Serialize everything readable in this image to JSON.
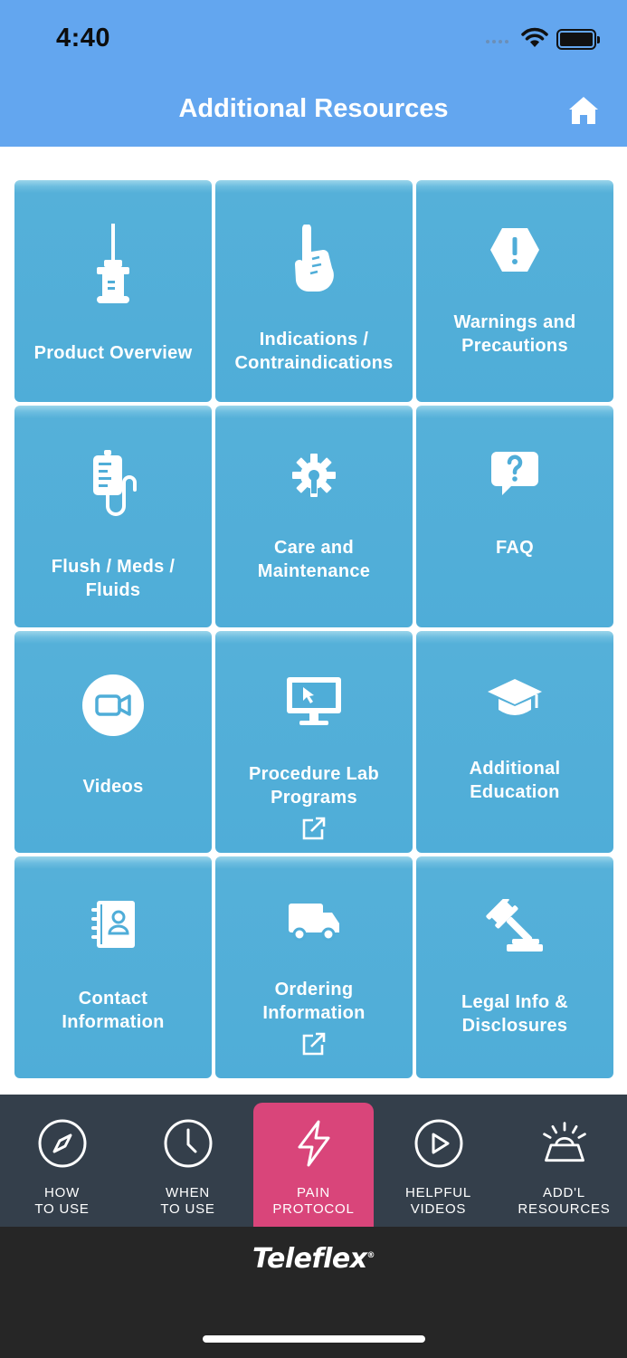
{
  "status_bar": {
    "time": "4:40"
  },
  "header": {
    "title": "Additional Resources",
    "home_icon": "home-icon"
  },
  "tiles": [
    {
      "label": "Product Overview",
      "icon": "catheter-icon",
      "external": false
    },
    {
      "label": "Indications /\nContraindications",
      "icon": "pointing-hand-icon",
      "external": false
    },
    {
      "label": "Warnings and\nPrecautions",
      "icon": "warning-hexagon-icon",
      "external": false
    },
    {
      "label": "Flush / Meds /\nFluids",
      "icon": "iv-bag-icon",
      "external": false
    },
    {
      "label": "Care and\nMaintenance",
      "icon": "wrench-gear-icon",
      "external": false
    },
    {
      "label": "FAQ",
      "icon": "question-bubble-icon",
      "external": false
    },
    {
      "label": "Videos",
      "icon": "video-camera-icon",
      "external": false
    },
    {
      "label": "Procedure Lab\nPrograms",
      "icon": "monitor-cursor-icon",
      "external": true
    },
    {
      "label": "Additional\nEducation",
      "icon": "graduation-cap-icon",
      "external": false
    },
    {
      "label": "Contact\nInformation",
      "icon": "address-book-icon",
      "external": false
    },
    {
      "label": "Ordering\nInformation",
      "icon": "delivery-truck-icon",
      "external": true
    },
    {
      "label": "Legal Info &\nDisclosures",
      "icon": "gavel-icon",
      "external": false
    }
  ],
  "tabbar": {
    "active_index": 2,
    "tabs": [
      {
        "label": "HOW\nTO USE",
        "icon": "compass-icon"
      },
      {
        "label": "WHEN\nTO USE",
        "icon": "clock-icon"
      },
      {
        "label": "PAIN\nPROTOCOL",
        "icon": "lightning-icon"
      },
      {
        "label": "HELPFUL\nVIDEOS",
        "icon": "play-icon"
      },
      {
        "label": "ADD'L\nRESOURCES",
        "icon": "siren-icon"
      }
    ]
  },
  "footer": {
    "brand": "Teleflex"
  },
  "colors": {
    "header": "#63a6ef",
    "tile": "#4fadd8",
    "tabbar": "#343f4b",
    "tab_active": "#d9457a",
    "footer": "#262626"
  }
}
